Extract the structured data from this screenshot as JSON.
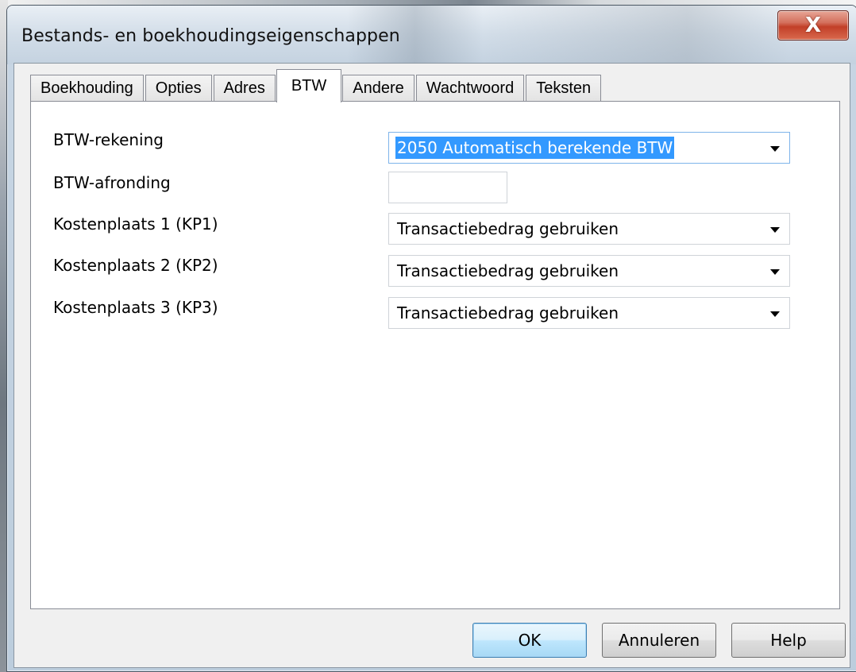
{
  "window": {
    "title": "Bestands- en boekhoudingseigenschappen",
    "close_label": "X"
  },
  "tabs": [
    {
      "label": "Boekhouding",
      "active": false
    },
    {
      "label": "Opties",
      "active": false
    },
    {
      "label": "Adres",
      "active": false
    },
    {
      "label": "BTW",
      "active": true
    },
    {
      "label": "Andere",
      "active": false
    },
    {
      "label": "Wachtwoord",
      "active": false
    },
    {
      "label": "Teksten",
      "active": false
    }
  ],
  "form": {
    "btw_rekening": {
      "label": "BTW-rekening",
      "value": "2050 Automatisch berekende BTW"
    },
    "btw_afronding": {
      "label": "BTW-afronding",
      "value": ""
    },
    "kp1": {
      "label": "Kostenplaats 1 (KP1)",
      "value": "Transactiebedrag gebruiken"
    },
    "kp2": {
      "label": "Kostenplaats 2 (KP2)",
      "value": "Transactiebedrag gebruiken"
    },
    "kp3": {
      "label": "Kostenplaats 3 (KP3)",
      "value": "Transactiebedrag gebruiken"
    }
  },
  "buttons": {
    "ok": "OK",
    "cancel": "Annuleren",
    "help": "Help"
  },
  "colors": {
    "selection": "#3399ff",
    "close_button": "#c23f28"
  }
}
